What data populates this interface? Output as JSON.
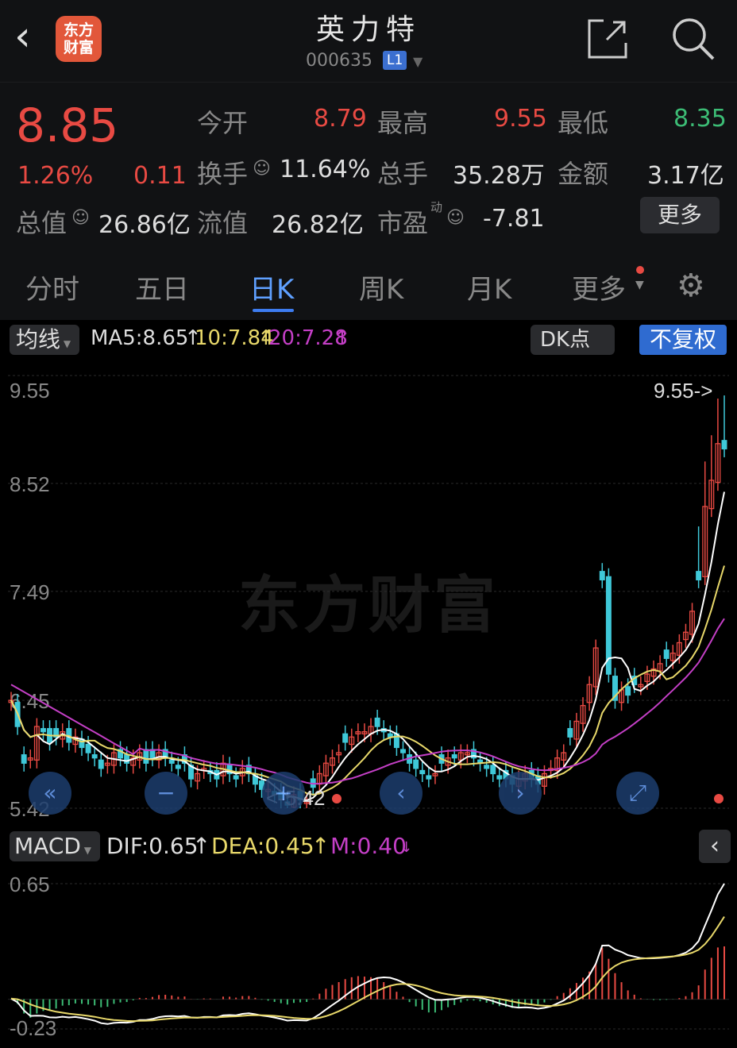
{
  "header": {
    "back_icon": "chevron-left-icon",
    "logo_line1": "东方",
    "logo_line2": "财富",
    "stock_name": "英力特",
    "stock_code": "000635",
    "level": "L1",
    "share_icon": "share-icon",
    "search_icon": "search-icon"
  },
  "quote": {
    "price": "8.85",
    "change_pct": "1.26%",
    "change": "0.11",
    "open_label": "今开",
    "open": "8.79",
    "high_label": "最高",
    "high": "9.55",
    "low_label": "最低",
    "low": "8.35",
    "turnover_label": "换手",
    "turnover": "11.64%",
    "volume_label": "总手",
    "volume": "35.28万",
    "amount_label": "金额",
    "amount": "3.17亿",
    "mktcap_label": "总值",
    "mktcap": "26.86亿",
    "float_label": "流值",
    "float": "26.82亿",
    "pe_label": "市盈",
    "pe_sup": "动",
    "pe": "-7.81",
    "more": "更多"
  },
  "tabs": [
    "分时",
    "五日",
    "日K",
    "周K",
    "月K",
    "更多"
  ],
  "active_tab": 2,
  "ma_bar": {
    "selector": "均线",
    "ma5": "MA5:8.65",
    "ma10": "10:7.84",
    "ma20": "20:7.28",
    "dk": "DK点",
    "adjust": "不复权"
  },
  "macd_bar": {
    "selector": "MACD",
    "dif": "DIF:0.65",
    "dea": "DEA:0.45",
    "m": "M:0.40"
  },
  "colors": {
    "up": "#e84a43",
    "down": "#3fc8d8",
    "ma5": "#ffffff",
    "ma10": "#e8d86a",
    "ma20": "#c43fc6",
    "accent": "#3d7cf0"
  },
  "watermark": "东方财富",
  "chart_data": [
    {
      "type": "candlestick",
      "ylim": [
        5.42,
        9.55
      ],
      "y_ticks": [
        "9.55",
        "8.52",
        "7.49",
        "6.45",
        "5.42"
      ],
      "high_annotation": "9.55->",
      "low_annotation": "<-5.42",
      "closes": [
        6.45,
        6.2,
        5.85,
        5.9,
        6.2,
        6.15,
        6.05,
        6.1,
        6.15,
        6.05,
        6.1,
        6.0,
        5.95,
        5.9,
        5.8,
        5.85,
        5.95,
        5.9,
        5.85,
        5.9,
        5.95,
        5.85,
        5.9,
        5.95,
        5.9,
        5.85,
        5.8,
        5.85,
        5.7,
        5.75,
        5.8,
        5.75,
        5.7,
        5.85,
        5.75,
        5.7,
        5.8,
        5.75,
        5.65,
        5.6,
        5.6,
        5.55,
        5.5,
        5.45,
        5.55,
        5.5,
        5.48,
        5.62,
        5.75,
        5.85,
        5.9,
        5.95,
        6.05,
        6.1,
        6.15,
        6.15,
        6.2,
        6.2,
        6.15,
        6.1,
        6.0,
        5.95,
        5.85,
        5.8,
        5.75,
        5.7,
        5.75,
        5.85,
        5.9,
        5.9,
        5.95,
        5.95,
        5.9,
        5.85,
        5.8,
        5.75,
        5.7,
        5.7,
        5.65,
        5.7,
        5.75,
        5.7,
        5.65,
        5.75,
        5.8,
        5.9,
        5.95,
        6.1,
        6.25,
        6.4,
        6.6,
        6.95,
        7.6,
        6.7,
        6.45,
        6.55,
        6.5,
        6.6,
        6.6,
        6.7,
        6.75,
        6.8,
        6.85,
        6.9,
        7.0,
        7.1,
        7.3,
        7.6,
        8.3,
        8.55,
        8.9,
        8.85
      ],
      "series": [
        {
          "name": "MA5",
          "last": 8.65
        },
        {
          "name": "MA10",
          "last": 7.84
        },
        {
          "name": "MA20",
          "last": 7.28
        }
      ]
    },
    {
      "type": "macd",
      "ylim": [
        -0.23,
        0.65
      ],
      "y_ticks": [
        "0.65",
        "-0.23"
      ],
      "dif_last": 0.65,
      "dea_last": 0.45,
      "m_last": 0.4
    }
  ]
}
